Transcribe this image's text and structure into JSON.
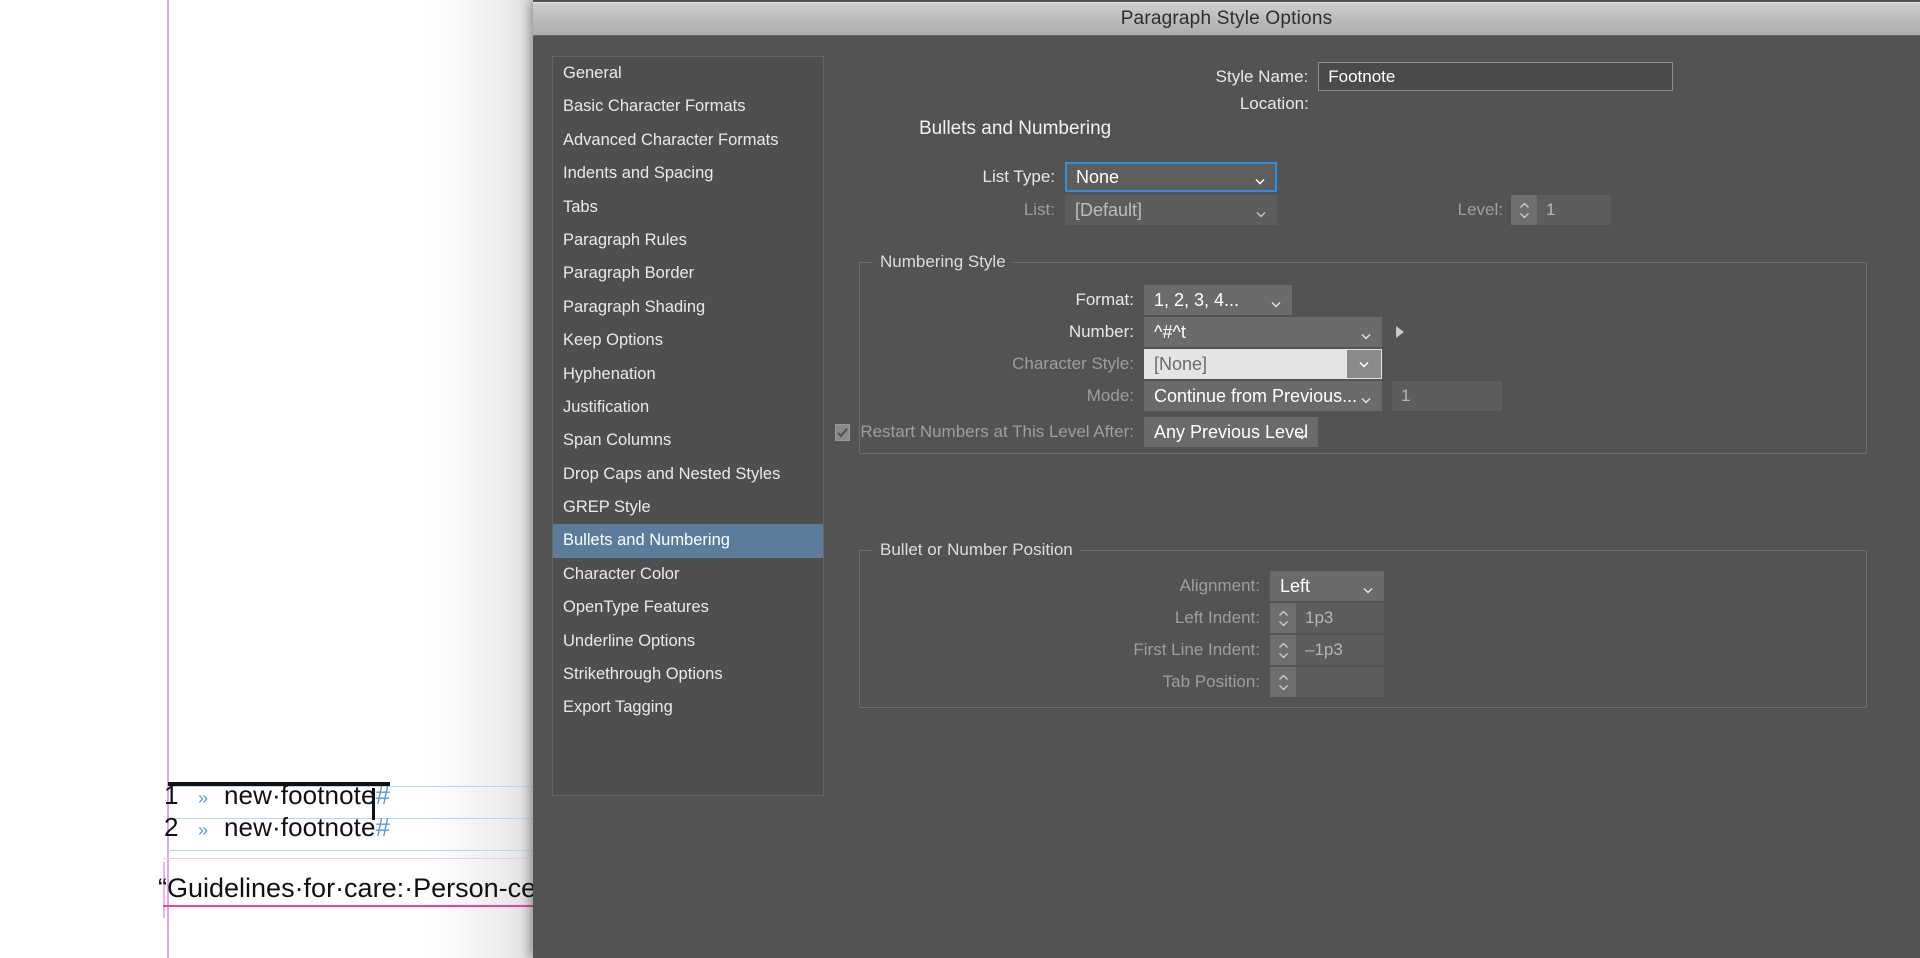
{
  "document": {
    "footnotes": [
      {
        "number": "1",
        "tab": "»",
        "text": "new·footnote",
        "marker": "#"
      },
      {
        "number": "2",
        "tab": "»",
        "text": "new·footnote",
        "marker": "#"
      }
    ],
    "body_text": "“Guidelines·for·care:·Person-cent"
  },
  "dialog": {
    "title": "Paragraph Style Options",
    "nav": {
      "items": [
        "General",
        "Basic Character Formats",
        "Advanced Character Formats",
        "Indents and Spacing",
        "Tabs",
        "Paragraph Rules",
        "Paragraph Border",
        "Paragraph Shading",
        "Keep Options",
        "Hyphenation",
        "Justification",
        "Span Columns",
        "Drop Caps and Nested Styles",
        "GREP Style",
        "Bullets and Numbering",
        "Character Color",
        "OpenType Features",
        "Underline Options",
        "Strikethrough Options",
        "Export Tagging"
      ],
      "selected_index": 14,
      "selected_label": "Bullets and Numbering"
    },
    "header": {
      "style_name_label": "Style Name:",
      "style_name_value": "Footnote",
      "location_label": "Location:",
      "location_value": ""
    },
    "section_title": "Bullets and Numbering",
    "list_type": {
      "label": "List Type:",
      "value": "None"
    },
    "list": {
      "label": "List:",
      "value": "[Default]"
    },
    "level": {
      "label": "Level:",
      "value": "1"
    },
    "numbering_style": {
      "group_title": "Numbering Style",
      "format": {
        "label": "Format:",
        "value": "1, 2, 3, 4..."
      },
      "number": {
        "label": "Number:",
        "value": "^#^t"
      },
      "character_style": {
        "label": "Character Style:",
        "value": "[None]"
      },
      "mode": {
        "label": "Mode:",
        "value": "Continue from Previous...",
        "start_at": "1"
      },
      "restart": {
        "label": "Restart Numbers at This Level After:",
        "checked": true,
        "value": "Any Previous Level"
      }
    },
    "bullet_position": {
      "group_title": "Bullet or Number Position",
      "alignment": {
        "label": "Alignment:",
        "value": "Left"
      },
      "left_indent": {
        "label": "Left Indent:",
        "value": "1p3"
      },
      "first_line_indent": {
        "label": "First Line Indent:",
        "value": "–1p3"
      },
      "tab_position": {
        "label": "Tab Position:",
        "value": ""
      }
    }
  },
  "colors": {
    "dialog_bg": "#535353",
    "nav_bg": "#4f4f4f",
    "selection": "#5b7c9b",
    "focus_blue": "#2a8fe0",
    "guide_purple": "#d9a8f5",
    "tab_marker_blue": "#5b9bd5",
    "pink_frame": "#f03fa0"
  }
}
